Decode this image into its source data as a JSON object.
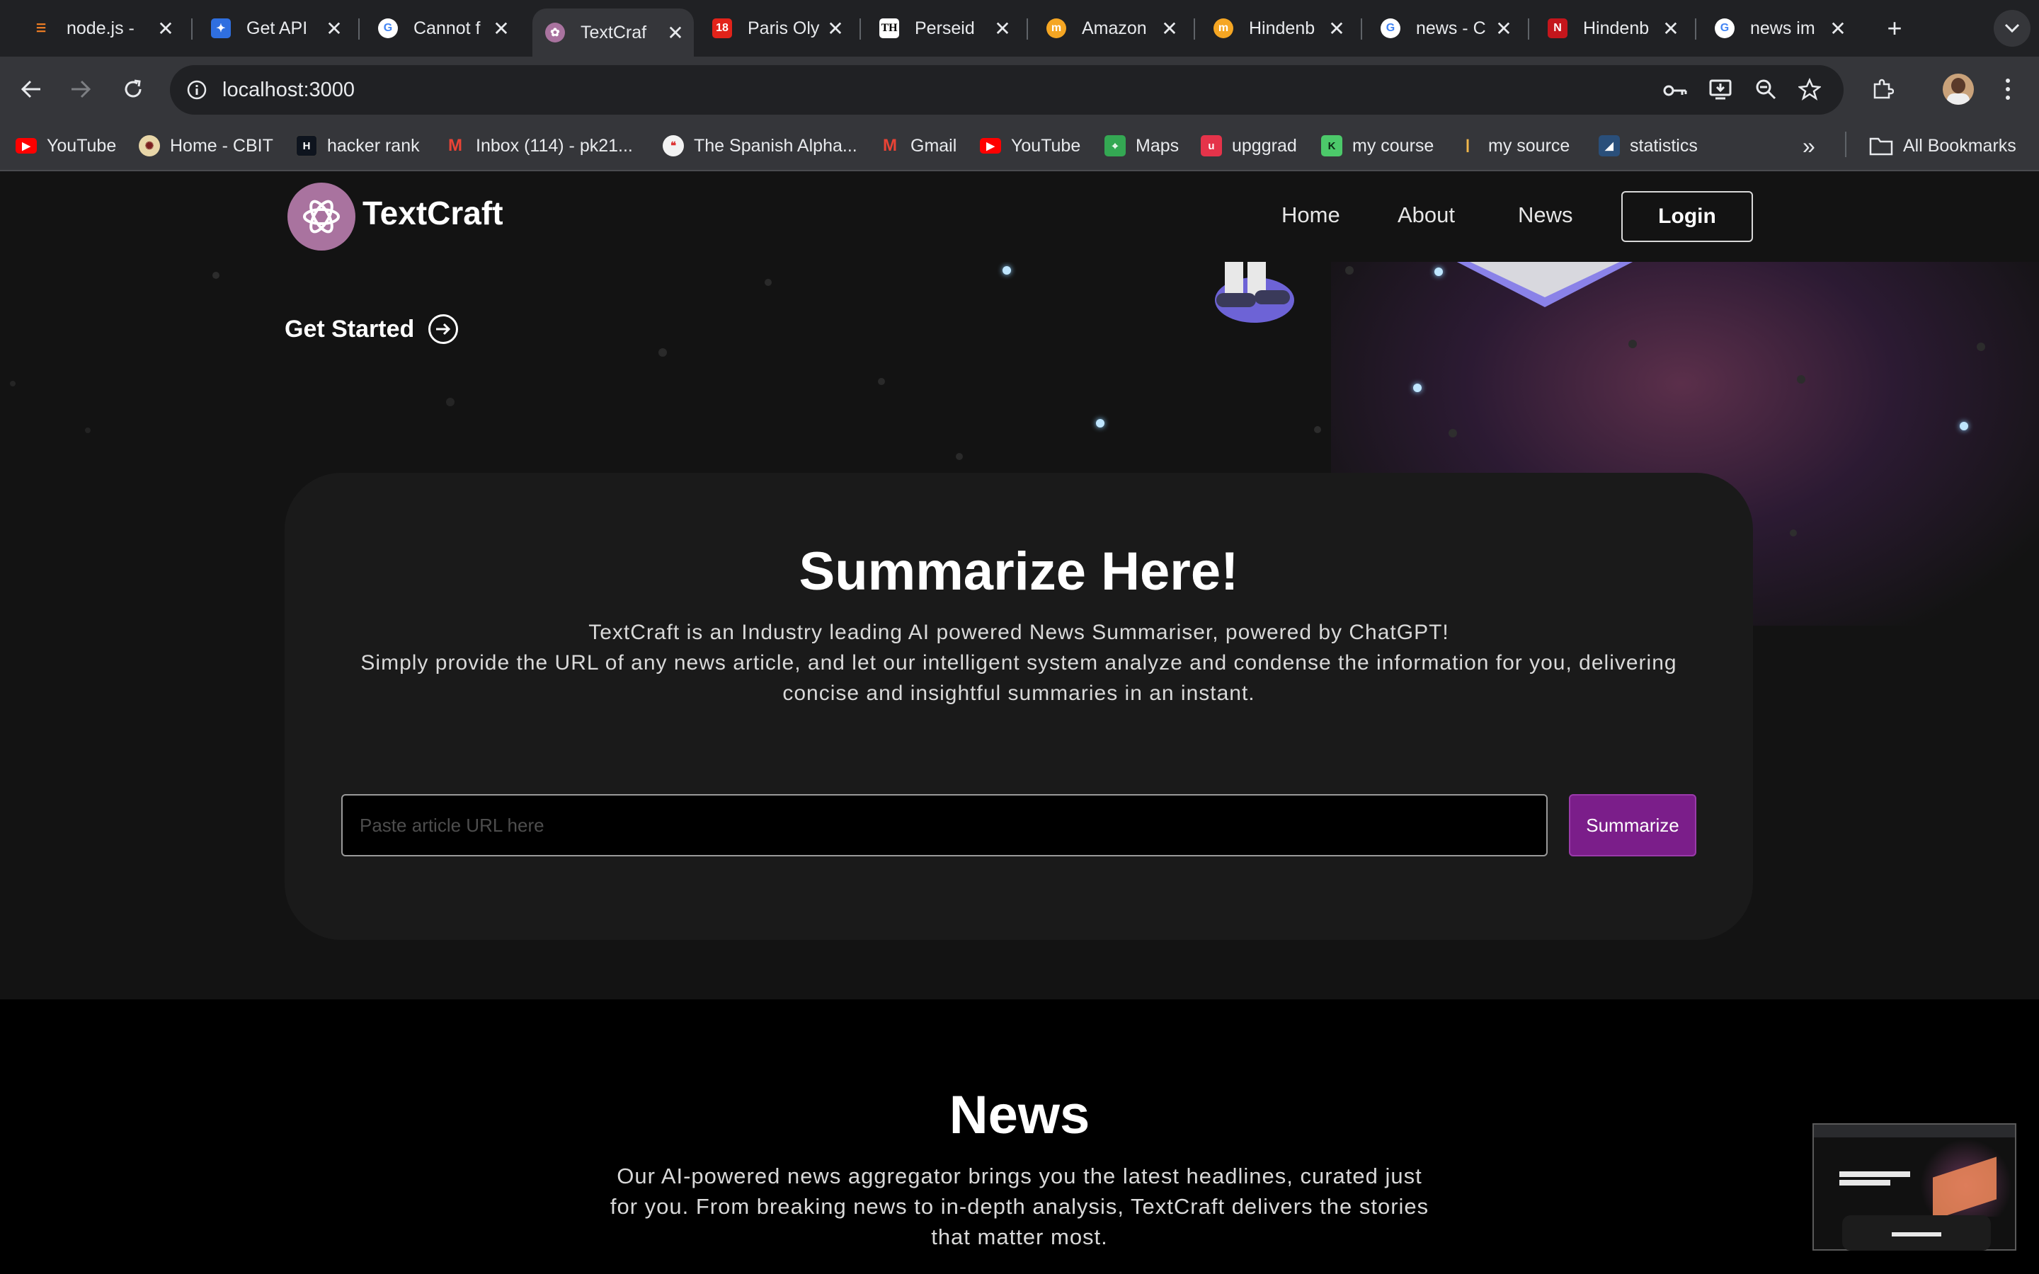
{
  "browser": {
    "tabs": [
      {
        "title": "node.js -",
        "icon": "stack-overflow-icon",
        "color": "#f48024"
      },
      {
        "title": "Get API",
        "icon": "api-icon",
        "color": "#2f6fe0"
      },
      {
        "title": "Cannot f",
        "icon": "google-icon",
        "color": "#ffffff"
      },
      {
        "title": "TextCraf",
        "icon": "textcraft-icon",
        "color": "#a9739f",
        "active": true
      },
      {
        "title": "Paris Oly",
        "icon": "news18-icon",
        "color": "#e2231a"
      },
      {
        "title": "Perseid",
        "icon": "th-icon",
        "color": "#ffffff"
      },
      {
        "title": "Amazon",
        "icon": "moneycontrol-icon",
        "color": "#f5a623"
      },
      {
        "title": "Hindenb",
        "icon": "moneycontrol-icon",
        "color": "#f5a623"
      },
      {
        "title": "news - C",
        "icon": "google-icon",
        "color": "#ffffff"
      },
      {
        "title": "Hindenb",
        "icon": "ndtv-icon",
        "color": "#c4161c"
      },
      {
        "title": "news im",
        "icon": "google-icon",
        "color": "#ffffff"
      }
    ],
    "new_tab": "+",
    "url": "localhost:3000",
    "bookmarks": [
      {
        "label": "YouTube",
        "icon": "youtube-icon"
      },
      {
        "label": "Home - CBIT",
        "icon": "cbit-icon"
      },
      {
        "label": "hacker rank",
        "icon": "hackerrank-icon"
      },
      {
        "label": "Inbox (114) - pk21...",
        "icon": "gmail-icon"
      },
      {
        "label": "The Spanish Alpha...",
        "icon": "speech-icon"
      },
      {
        "label": "Gmail",
        "icon": "gmail-icon"
      },
      {
        "label": "YouTube",
        "icon": "youtube-icon"
      },
      {
        "label": "Maps",
        "icon": "maps-icon"
      },
      {
        "label": "upggrad",
        "icon": "upgrad-icon"
      },
      {
        "label": "my course",
        "icon": "course-icon"
      },
      {
        "label": "my source",
        "icon": "source-icon"
      },
      {
        "label": "statistics",
        "icon": "statistics-icon"
      }
    ],
    "overflow": "»",
    "all_bookmarks": "All Bookmarks"
  },
  "site": {
    "brand": "TextCraft",
    "nav": {
      "home": "Home",
      "about": "About",
      "news": "News",
      "login": "Login"
    },
    "hero": {
      "get_started": "Get Started"
    },
    "summarize": {
      "title": "Summarize Here!",
      "line1": "TextCraft is an Industry leading AI powered News Summariser, powered by ChatGPT!",
      "line2": "Simply provide the URL of any news article, and let our intelligent system analyze and condense the information for you, delivering",
      "line3": "concise and insightful summaries in an instant.",
      "input_placeholder": "Paste article URL here",
      "input_value": "",
      "button": "Summarize"
    },
    "news": {
      "title": "News",
      "line1": "Our AI-powered news aggregator brings you the latest headlines, curated just",
      "line2": "for you. From breaking news to in-depth analysis, TextCraft delivers the stories",
      "line3": "that matter most."
    }
  },
  "colors": {
    "accent": "#7b1e8a",
    "logo": "#a9739f",
    "page_bg": "#131313",
    "card_bg": "#1a1a1a"
  }
}
